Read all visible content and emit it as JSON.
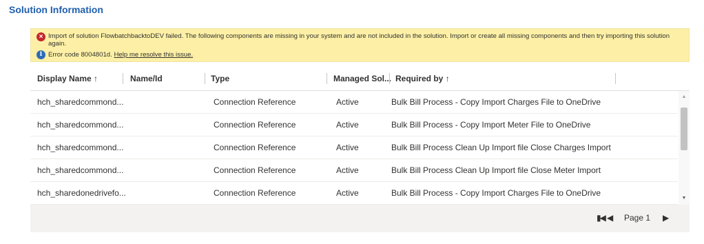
{
  "page": {
    "title": "Solution Information"
  },
  "alert": {
    "error_icon": "error-circle-icon",
    "message": "Import of solution FlowbatchbacktoDEV failed. The following components are missing in your system and are not included in the solution. Import or create all missing components and then try importing this solution again.",
    "info_icon": "info-circle-icon",
    "error_code": "Error code 8004801d.",
    "help_link": "Help me resolve this issue."
  },
  "table": {
    "columns": [
      {
        "label": "Display Name",
        "sort": "↑"
      },
      {
        "label": "Name/Id",
        "sort": ""
      },
      {
        "label": "Type",
        "sort": ""
      },
      {
        "label": "Managed Sol...",
        "sort": ""
      },
      {
        "label": "Required by",
        "sort": "↑"
      }
    ],
    "rows": [
      {
        "display_name": "hch_sharedcommond...",
        "name_id": "",
        "type": "Connection Reference",
        "managed": "Active",
        "required_by": "Bulk Bill Process - Copy Import Charges File to OneDrive"
      },
      {
        "display_name": "hch_sharedcommond...",
        "name_id": "",
        "type": "Connection Reference",
        "managed": "Active",
        "required_by": "Bulk Bill Process - Copy Import Meter File to OneDrive"
      },
      {
        "display_name": "hch_sharedcommond...",
        "name_id": "",
        "type": "Connection Reference",
        "managed": "Active",
        "required_by": "Bulk Bill Process Clean Up Import file Close Charges Import"
      },
      {
        "display_name": "hch_sharedcommond...",
        "name_id": "",
        "type": "Connection Reference",
        "managed": "Active",
        "required_by": "Bulk Bill Process Clean Up Import file Close Meter Import"
      },
      {
        "display_name": "hch_sharedonedrivefo...",
        "name_id": "",
        "type": "Connection Reference",
        "managed": "Active",
        "required_by": "Bulk Bill Process - Copy Import Charges File to OneDrive"
      }
    ]
  },
  "pagination": {
    "first_icon": "first-page-icon",
    "prev_icon": "previous-page-icon",
    "label": "Page 1",
    "next_icon": "next-page-icon"
  },
  "colors": {
    "title": "#1f5fad",
    "alert_bg": "#fdf0a6",
    "error": "#c4262e",
    "info": "#2d6db8"
  }
}
